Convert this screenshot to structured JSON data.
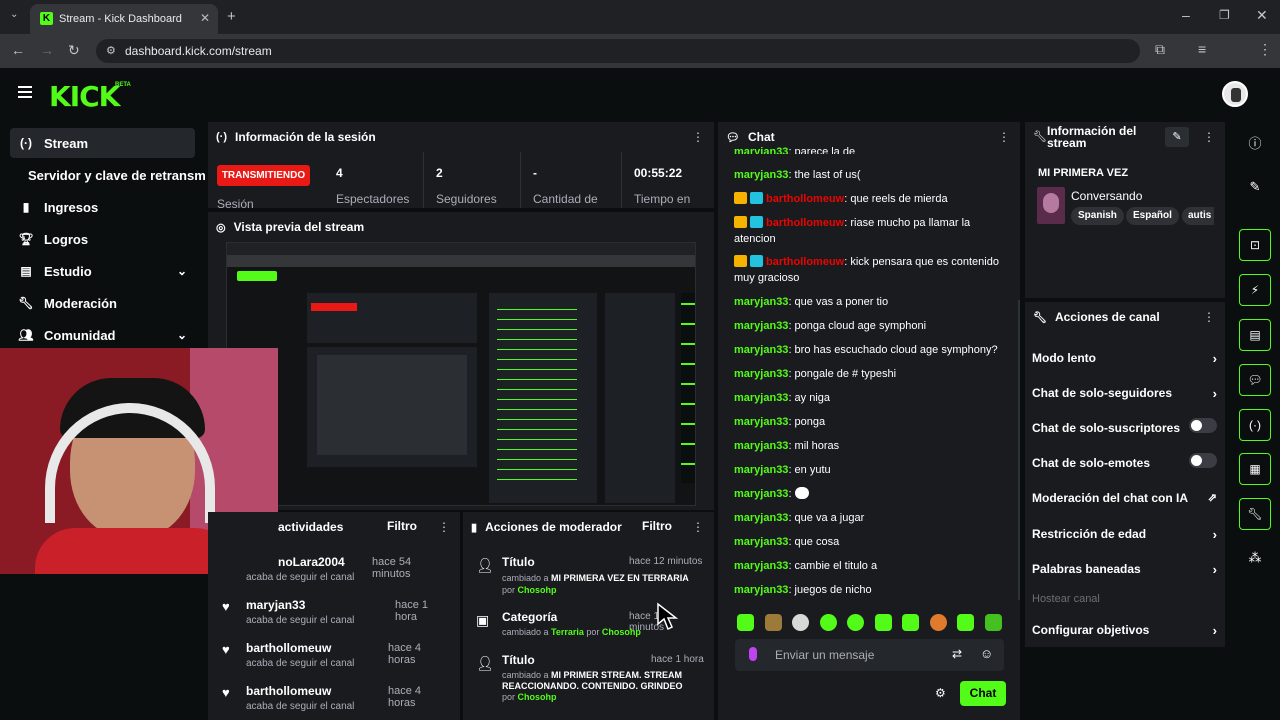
{
  "browser": {
    "tab_title": "Stream - Kick Dashboard",
    "url": "dashboard.kick.com/stream"
  },
  "brand": {
    "logo": "KICK",
    "beta": "BETA",
    "accent": "#53fc18"
  },
  "sidebar": {
    "items": [
      {
        "label": "Stream",
        "icon": "broadcast-icon"
      },
      {
        "label": "Servidor y clave de retransm"
      },
      {
        "label": "Ingresos",
        "icon": "chart-icon"
      },
      {
        "label": "Logros",
        "icon": "trophy-icon"
      },
      {
        "label": "Estudio",
        "icon": "studio-icon"
      },
      {
        "label": "Moderación",
        "icon": "wrench-icon"
      },
      {
        "label": "Comunidad",
        "icon": "people-icon"
      }
    ]
  },
  "session": {
    "title": "Información de la sesión",
    "live_badge": "TRANSMITIENDO",
    "live_sub": "Sesión",
    "stats": [
      {
        "value": "4",
        "label": "Espectadores"
      },
      {
        "value": "2",
        "label": "Seguidores"
      },
      {
        "value": "-",
        "label": "Cantidad de"
      },
      {
        "value": "00:55:22",
        "label": "Tiempo en"
      }
    ]
  },
  "preview": {
    "title": "Vista previa del stream"
  },
  "activity": {
    "title": "actividades",
    "filter": "Filtro",
    "items": [
      {
        "user": "noLara2004",
        "time": "hace 54 minutos",
        "desc": "acaba de seguir el canal"
      },
      {
        "user": "maryjan33",
        "time": "hace 1 hora",
        "desc": "acaba de seguir el canal"
      },
      {
        "user": "barthollomeuw",
        "time": "hace 4 horas",
        "desc": "acaba de seguir el canal"
      },
      {
        "user": "barthollomeuw",
        "time": "hace 4 horas",
        "desc": "acaba de seguir el canal"
      }
    ]
  },
  "modactions": {
    "title": "Acciones de moderador",
    "filter": "Filtro",
    "items": [
      {
        "kind": "Título",
        "time": "hace 12 minutos",
        "pre": "cambiado a ",
        "value": "MI PRIMERA VEZ EN TERRARIA",
        "by_pre": "por ",
        "by": "Chosohp"
      },
      {
        "kind": "Categoría",
        "time": "hace 1... minutos",
        "pre": "cambiado a ",
        "value": "Terraria",
        "by_pre": " por ",
        "by": "Chosohp"
      },
      {
        "kind": "Título",
        "time": "hace 1 hora",
        "pre": "cambiado a ",
        "value": "MI PRIMER STREAM. STREAM REACCIONANDO. CONTENIDO. GRINDEO",
        "by_pre": "por ",
        "by": "Chosohp"
      }
    ]
  },
  "chat": {
    "title": "Chat",
    "messages": [
      {
        "user": "maryjan33",
        "text": ": parece la de"
      },
      {
        "user": "maryjan33",
        "text": ": the last of us("
      },
      {
        "user": "barthollomeuw",
        "text": ": que reels de mierda",
        "badges": true
      },
      {
        "user": "barthollomeuw",
        "text": ": riase mucho pa llamar la atencion",
        "badges": true
      },
      {
        "user": "barthollomeuw",
        "text": ": kick pensara que es contenido muy gracioso",
        "badges": true
      },
      {
        "user": "maryjan33",
        "text": ": que vas a poner tio"
      },
      {
        "user": "maryjan33",
        "text": ": ponga cloud age symphoni"
      },
      {
        "user": "maryjan33",
        "text": ": bro has escuchado cloud age symphony?"
      },
      {
        "user": "maryjan33",
        "text": ": pongale de # typeshi"
      },
      {
        "user": "maryjan33",
        "text": ": ay niga"
      },
      {
        "user": "maryjan33",
        "text": ": ponga"
      },
      {
        "user": "maryjan33",
        "text": ": mil horas"
      },
      {
        "user": "maryjan33",
        "text": ": en yutu"
      },
      {
        "user": "maryjan33",
        "text": ":"
      },
      {
        "user": "maryjan33",
        "text": ": que va a jugar"
      },
      {
        "user": "maryjan33",
        "text": ": que cosa"
      },
      {
        "user": "maryjan33",
        "text": ": cambie el titulo a"
      },
      {
        "user": "maryjan33",
        "text": ": juegos de nicho"
      }
    ],
    "placeholder": "Enviar un mensaje",
    "send": "Chat"
  },
  "streaminfo": {
    "title": "Información del stream",
    "stream_title": "MI PRIMERA VEZ",
    "category": "Conversando",
    "tags": [
      "Spanish",
      "Español",
      "autis"
    ]
  },
  "channel_actions": {
    "title": "Acciones de canal",
    "items": [
      {
        "label": "Modo lento",
        "ctrl": "chevron"
      },
      {
        "label": "Chat de solo-seguidores",
        "ctrl": "chevron"
      },
      {
        "label": "Chat de solo-suscriptores",
        "ctrl": "toggle"
      },
      {
        "label": "Chat de solo-emotes",
        "ctrl": "toggle"
      },
      {
        "label": "Moderación del chat con IA",
        "ctrl": "external"
      },
      {
        "label": "Restricción de edad",
        "ctrl": "chevron"
      },
      {
        "label": "Palabras baneadas",
        "ctrl": "chevron"
      },
      {
        "label": "Hostear canal",
        "ctrl": "none",
        "disabled": true
      },
      {
        "label": "Configurar objetivos",
        "ctrl": "chevron"
      }
    ]
  }
}
